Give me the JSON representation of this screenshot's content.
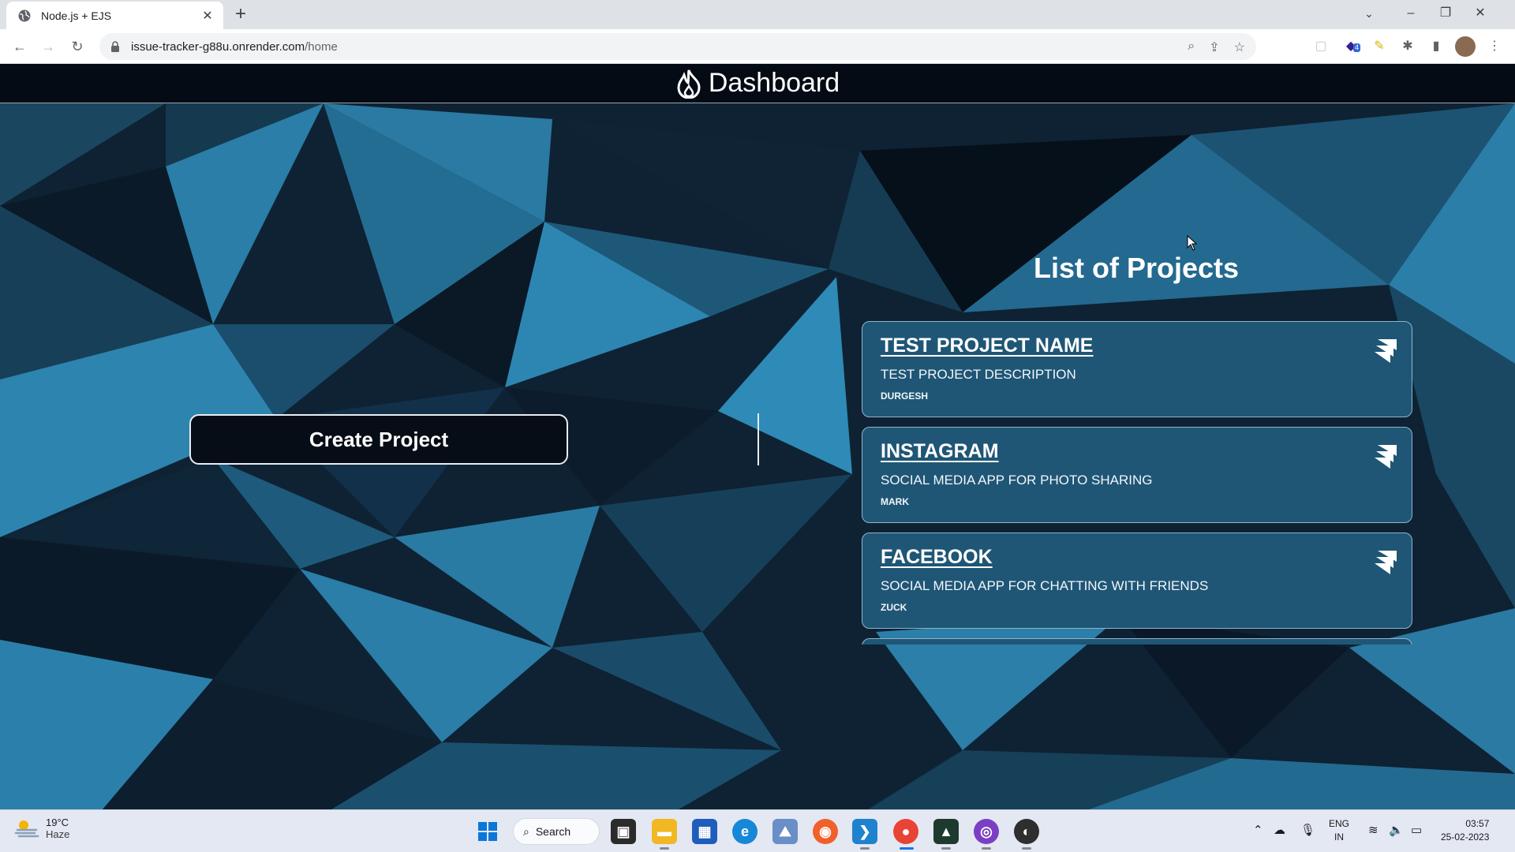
{
  "browser": {
    "tab_title": "Node.js + EJS",
    "tab_close": "✕",
    "new_tab": "+",
    "url_host": "issue-tracker-g88u.onrender.com",
    "url_path": "/home",
    "window_controls": [
      "⌄",
      "–",
      "❐",
      "✕"
    ],
    "extension_badge": "4"
  },
  "navbar": {
    "brand": "Dashboard"
  },
  "main": {
    "create_button": "Create Project",
    "projects_heading": "List of Projects",
    "projects": [
      {
        "name": "TEST PROJECT NAME",
        "description": "TEST PROJECT DESCRIPTION",
        "author": "DURGESH"
      },
      {
        "name": "INSTAGRAM",
        "description": "SOCIAL MEDIA APP FOR PHOTO SHARING",
        "author": "MARK"
      },
      {
        "name": "FACEBOOK",
        "description": "SOCIAL MEDIA APP FOR CHATTING WITH FRIENDS",
        "author": "ZUCK"
      }
    ]
  },
  "taskbar": {
    "weather_temp": "19°C",
    "weather_condition": "Haze",
    "search_label": "Search",
    "lang_line1": "ENG",
    "lang_line2": "IN",
    "time": "03:57",
    "date": "25-02-2023"
  },
  "colors": {
    "card_bg": "#1f5676",
    "navbar_bg": "#040b14",
    "button_bg": "#060d16"
  }
}
